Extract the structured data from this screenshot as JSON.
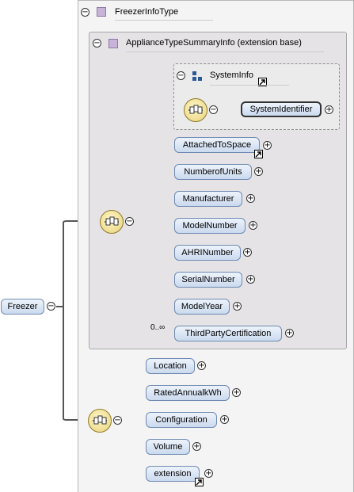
{
  "root": {
    "label": "Freezer"
  },
  "type": {
    "name": "FreezerInfoType"
  },
  "extension": {
    "title": "ApplianceTypeSummaryInfo (extension base)"
  },
  "system_info": {
    "title": "SystemInfo",
    "child": "SystemIdentifier"
  },
  "ext_elements": [
    {
      "label": "AttachedToSpace"
    },
    {
      "label": "NumberofUnits"
    },
    {
      "label": "Manufacturer"
    },
    {
      "label": "ModelNumber"
    },
    {
      "label": "AHRINumber"
    },
    {
      "label": "SerialNumber"
    },
    {
      "label": "ModelYear"
    },
    {
      "label": "ThirdPartyCertification",
      "cardinality": "0..∞"
    }
  ],
  "own_elements": [
    {
      "label": "Location"
    },
    {
      "label": "RatedAnnualkWh"
    },
    {
      "label": "Configuration"
    },
    {
      "label": "Volume"
    },
    {
      "label": "extension"
    }
  ],
  "symbols": {
    "collapse": "−",
    "expand": "+"
  }
}
